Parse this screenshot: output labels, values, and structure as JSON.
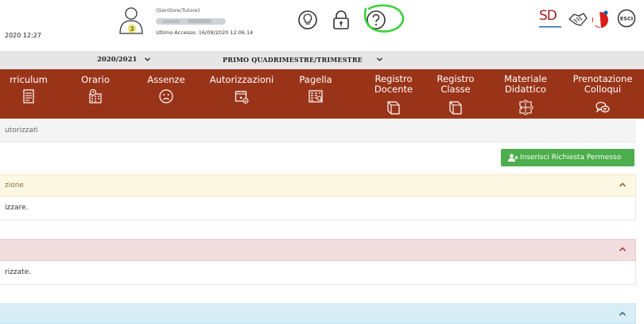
{
  "header": {
    "date_fragment": "2020 12:27",
    "avatar_badge": "3",
    "role": "(Genitore/Tutore)",
    "last_access": "Ultimo Accesso: 16/09/2020 12.06.14",
    "logo_text": "SD",
    "logout_label": "ESCI"
  },
  "period_bar": {
    "year": "2020/2021",
    "period": "PRIMO QUADRIMESTRE/TRIMESTRE"
  },
  "nav": {
    "items": [
      {
        "label": "rriculum",
        "icon": "document-icon"
      },
      {
        "label": "Orario",
        "icon": "calendar-clock-icon"
      },
      {
        "label": "Assenze",
        "icon": "sad-face-icon"
      },
      {
        "label": "Autorizzazioni",
        "icon": "calendar-check-icon"
      },
      {
        "label": "Pagella",
        "icon": "report-card-icon"
      },
      {
        "label": "Registro\nDocente",
        "icon": "book-icon"
      },
      {
        "label": "Registro\nClasse",
        "icon": "book-icon"
      },
      {
        "label": "Materiale\nDidattico",
        "icon": "puzzle-icon"
      },
      {
        "label": "Prenotazione\nColloqui",
        "icon": "chat-icon"
      }
    ]
  },
  "breadcrumb": "utorizzati",
  "request_button": {
    "label": "Inserisci Richiesta Permesso",
    "icon": "user-add-icon"
  },
  "panels": [
    {
      "title": "zione",
      "body": "izzare."
    },
    {
      "title": "",
      "body": "rizzate."
    },
    {
      "title": ""
    }
  ],
  "colors": {
    "nav_bg": "#9a3418",
    "button_green": "#4cae4c",
    "warning_bg": "#fcf8e3",
    "danger_bg": "#f2dede",
    "info_bg": "#d9edf7",
    "highlight_circle": "#3cd23c"
  }
}
